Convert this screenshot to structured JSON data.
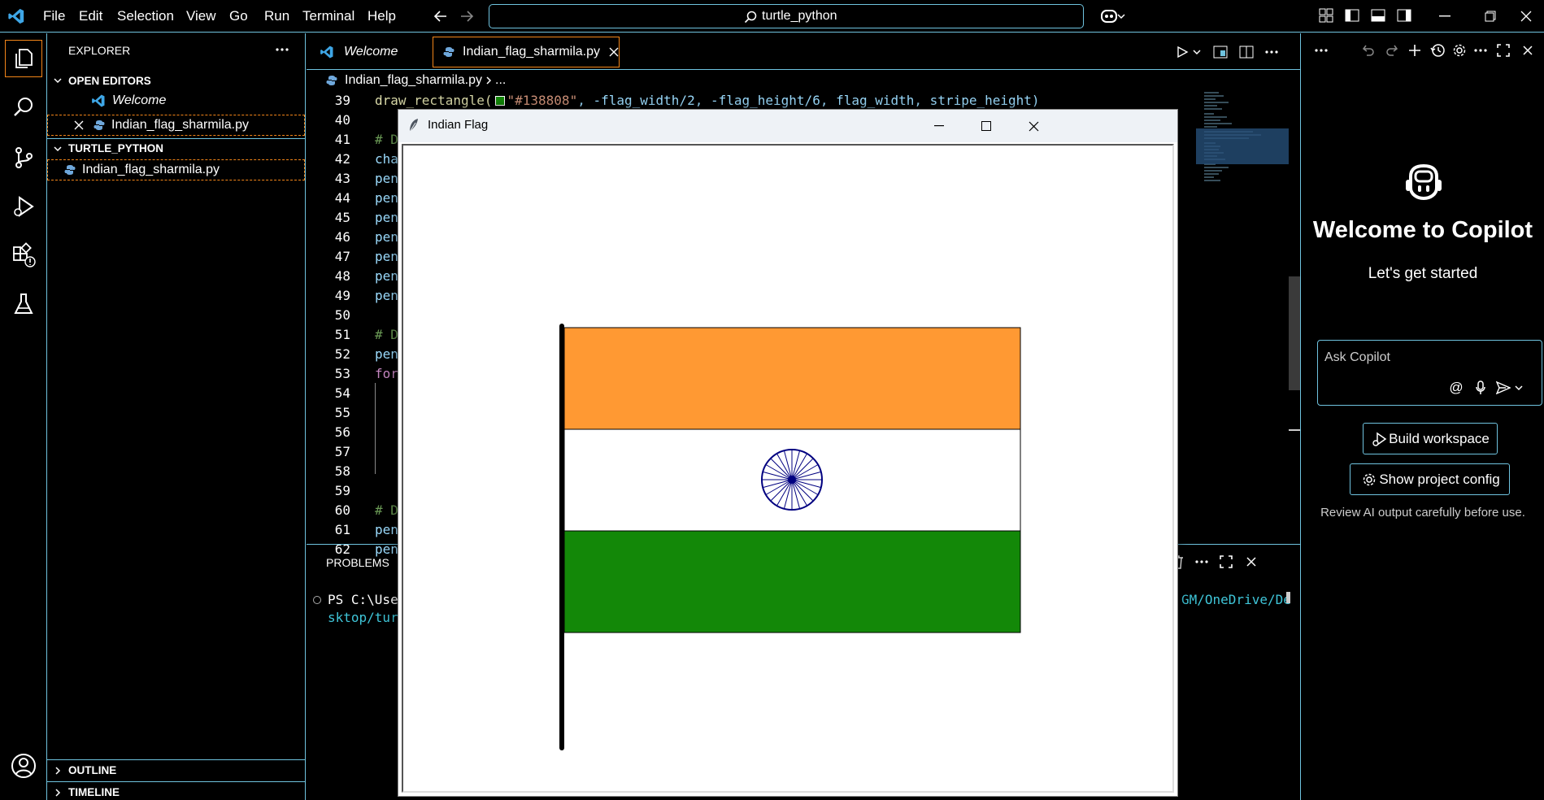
{
  "menu": [
    "File",
    "Edit",
    "Selection",
    "View",
    "Go",
    "Run",
    "Terminal",
    "Help"
  ],
  "command_center": {
    "text": "turtle_python"
  },
  "sidebar": {
    "title": "EXPLORER",
    "open_editors_label": "OPEN EDITORS",
    "open_editors": [
      {
        "name": "Welcome"
      },
      {
        "name": "Indian_flag_sharmila.py"
      }
    ],
    "folder_label": "TURTLE_PYTHON",
    "files": [
      {
        "name": "Indian_flag_sharmila.py"
      }
    ],
    "outline_label": "OUTLINE",
    "timeline_label": "TIMELINE"
  },
  "tabs": [
    {
      "label": "Welcome"
    },
    {
      "label": "Indian_flag_sharmila.py"
    }
  ],
  "breadcrumb": {
    "file": "Indian_flag_sharmila.py",
    "rest": "..."
  },
  "code": {
    "line_numbers": [
      "39",
      "40",
      "41",
      "42",
      "43",
      "44",
      "45",
      "46",
      "47",
      "48",
      "49",
      "50",
      "51",
      "52",
      "53",
      "54",
      "55",
      "56",
      "57",
      "58",
      "59",
      "60",
      "61",
      "62"
    ],
    "line39": {
      "func": "draw_rectangle(",
      "color": "\"#138808\"",
      "args": ", -flag_width/2, -flag_height/6, flag_width, stripe_height)"
    },
    "fragments": {
      "41": "# D",
      "42": "cha",
      "43": "pen",
      "44": "pen",
      "45": "pen",
      "46": "pen",
      "47": "pen",
      "48": "pen",
      "49": "pen",
      "51": "# D",
      "52": "pen",
      "53": "for",
      "60": "# D",
      "61": "pen",
      "62": "pen"
    }
  },
  "panel": {
    "tab": "PROBLEMS",
    "terminal_left_1": "PS C:\\User",
    "terminal_left_2": "sktop/turt",
    "terminal_right": "GM/OneDrive/De"
  },
  "copilot": {
    "title": "Welcome to Copilot",
    "subtitle": "Let's get started",
    "input_placeholder": "Ask Copilot",
    "build_button": "Build workspace",
    "config_button": "Show project config",
    "disclaimer": "Review AI output carefully before use."
  },
  "turtle_window": {
    "title": "Indian Flag"
  },
  "flag": {
    "saffron": "#FF9933",
    "white": "#FFFFFF",
    "green": "#138808",
    "chakra": "#000080",
    "chakra_spokes": 24
  },
  "colors": {
    "accent_border": "#6fc3df",
    "active_tab_border": "#f38518",
    "keyword": "#c586c0",
    "function": "#dcdcaa",
    "string": "#ce9178",
    "param": "#9cdcfe",
    "comment": "#6a9955"
  }
}
